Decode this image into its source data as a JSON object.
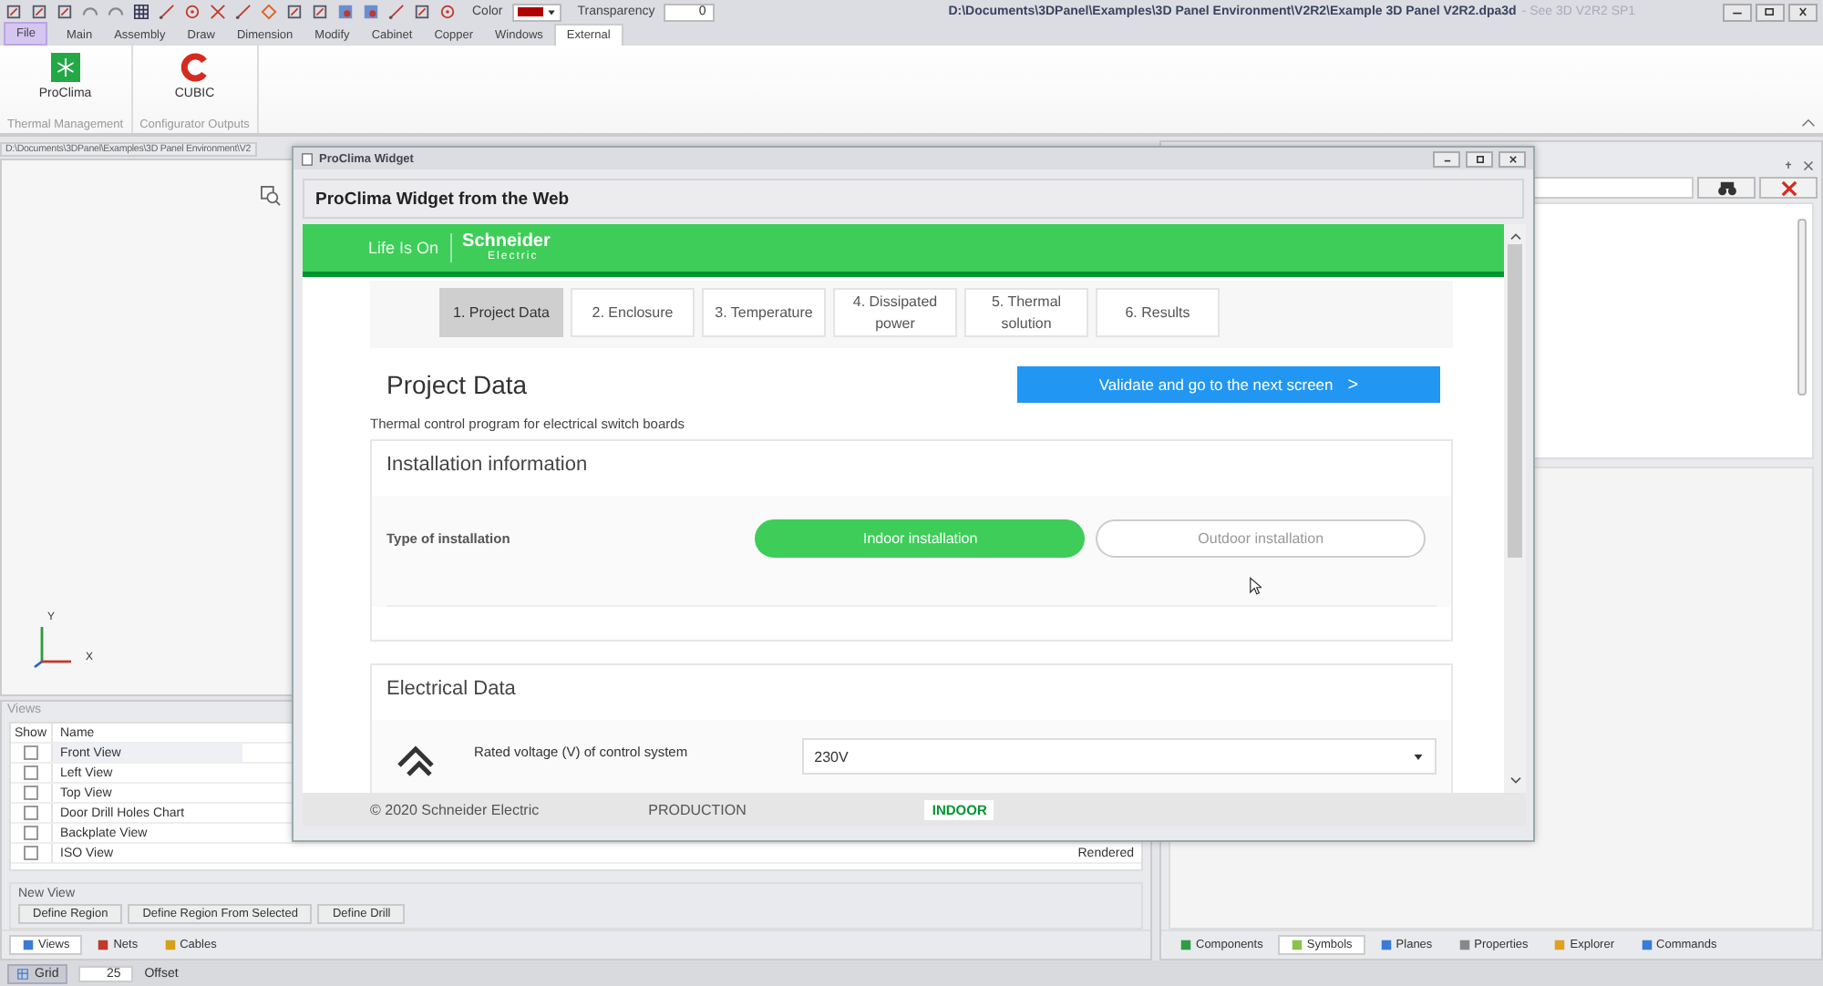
{
  "toolbar": {
    "color_label": "Color",
    "transparency_label": "Transparency",
    "transparency_value": "0"
  },
  "window": {
    "title": "D:\\Documents\\3DPanel\\Examples\\3D Panel Environment\\V2R2\\Example 3D Panel V2R2.dpa3d",
    "subtitle": "- See 3D V2R2 SP1"
  },
  "ribbon_tabs": [
    {
      "label": "File",
      "selected": false,
      "kind": "file"
    },
    {
      "label": "Main",
      "selected": false,
      "kind": "tab"
    },
    {
      "label": "Assembly",
      "selected": false,
      "kind": "tab"
    },
    {
      "label": "Draw",
      "selected": false,
      "kind": "tab"
    },
    {
      "label": "Dimension",
      "selected": false,
      "kind": "tab"
    },
    {
      "label": "Modify",
      "selected": false,
      "kind": "tab"
    },
    {
      "label": "Cabinet",
      "selected": false,
      "kind": "tab"
    },
    {
      "label": "Copper",
      "selected": false,
      "kind": "tab"
    },
    {
      "label": "Windows",
      "selected": false,
      "kind": "tab"
    },
    {
      "label": "External",
      "selected": true,
      "kind": "tab"
    }
  ],
  "ribbon_groups": [
    {
      "caption": "Thermal Management",
      "button": {
        "label": "ProClima",
        "kind": "proclima"
      }
    },
    {
      "caption": "Configurator Outputs",
      "button": {
        "label": "CUBIC",
        "kind": "cubic"
      }
    }
  ],
  "document_tab": "D:\\Documents\\3DPanel\\Examples\\3D Panel Environment\\V2",
  "axes": {
    "y_label": "Y",
    "x_label": "X"
  },
  "views_panel": {
    "title": "Views",
    "columns": [
      "Show",
      "Name"
    ],
    "rows": [
      {
        "name": "Front View",
        "checked": false,
        "selected": true
      },
      {
        "name": "Left View",
        "checked": false,
        "selected": false
      },
      {
        "name": "Top View",
        "checked": false,
        "selected": false
      },
      {
        "name": "Door Drill Holes Chart",
        "checked": false,
        "selected": false
      },
      {
        "name": "Backplate View",
        "checked": false,
        "selected": false
      },
      {
        "name": "ISO View",
        "checked": false,
        "selected": false,
        "column_3": "Rendered"
      }
    ],
    "new_view": {
      "title": "New View",
      "buttons": [
        "Define Region",
        "Define Region From Selected",
        "Define Drill"
      ]
    },
    "tabs": [
      {
        "label": "Views",
        "selected": true,
        "kind": "views"
      },
      {
        "label": "Nets",
        "selected": false,
        "kind": "nets"
      },
      {
        "label": "Cables",
        "selected": false,
        "kind": "cables"
      }
    ]
  },
  "right_panel": {
    "tabs": [
      {
        "label": "Components",
        "selected": false,
        "kind": "components"
      },
      {
        "label": "Symbols",
        "selected": true,
        "kind": "symbols"
      },
      {
        "label": "Planes",
        "selected": false,
        "kind": "planes"
      },
      {
        "label": "Properties",
        "selected": false,
        "kind": "properties"
      },
      {
        "label": "Explorer",
        "selected": false,
        "kind": "explorer"
      },
      {
        "label": "Commands",
        "selected": false,
        "kind": "commands"
      }
    ]
  },
  "status_bar": {
    "grid_label": "Grid",
    "grid_value": "25",
    "offset_label": "Offset"
  },
  "dialog": {
    "title": "ProClima Widget",
    "header": "ProClima Widget from the Web",
    "brand": {
      "tagline": "Life Is On",
      "name": "Schneider",
      "sub": "Electric"
    },
    "steps": [
      {
        "label": "1. Project Data",
        "selected": true
      },
      {
        "label": "2. Enclosure",
        "selected": false
      },
      {
        "label": "3. Temperature",
        "selected": false
      },
      {
        "label": "4. Dissipated power",
        "selected": false
      },
      {
        "label": "5. Thermal solution",
        "selected": false
      },
      {
        "label": "6. Results",
        "selected": false
      }
    ],
    "heading": "Project Data",
    "next_button": "Validate and go to the next screen",
    "next_arrow": ">",
    "description": "Thermal control program for electrical switch boards",
    "installation": {
      "title": "Installation information",
      "label": "Type of installation",
      "options": [
        {
          "label": "Indoor installation",
          "selected": true
        },
        {
          "label": "Outdoor installation",
          "selected": false
        }
      ]
    },
    "electrical": {
      "title": "Electrical Data",
      "label": "Rated voltage (V) of control system",
      "value": "230V"
    },
    "footer": {
      "copyright": "© 2020 Schneider Electric",
      "environment": "PRODUCTION",
      "mode": "INDOOR"
    }
  }
}
